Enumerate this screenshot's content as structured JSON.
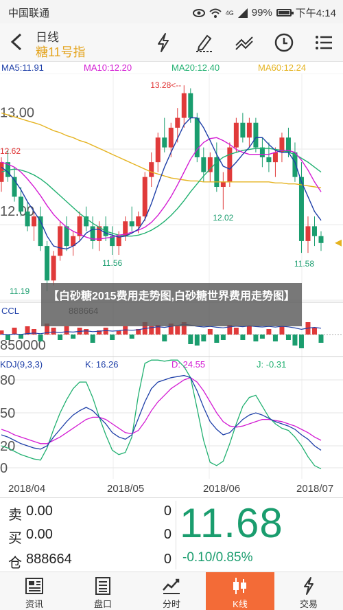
{
  "status": {
    "carrier": "中国联通",
    "signal_text": "4G",
    "battery": "99%",
    "time": "下午4:14"
  },
  "header": {
    "period": "日线",
    "instrument": "糖11号指"
  },
  "legend": {
    "ma5": "MA5:11.91",
    "ma10": "MA10:12.20",
    "ma20": "MA20:12.40",
    "ma60": "MA60:12.24",
    "colors": {
      "ma5": "#1e3fa8",
      "ma10": "#d31bd3",
      "ma20": "#20b070",
      "ma60": "#e5b320"
    }
  },
  "price_axis": [
    "13.00",
    "12.62",
    "12.00",
    "11.19"
  ],
  "annotations": {
    "high": "13.28<--",
    "low1": "11.56",
    "low2": "12.02",
    "low3": "11.58",
    "low0": "11.19<--"
  },
  "volume": {
    "label": "CCL",
    "value": "888664",
    "axis": "850000"
  },
  "kdj": {
    "label": "KDJ(9,3,3)",
    "k": "K: 16.26",
    "d": "D: 24.55",
    "j": "J: -0.31",
    "axis": [
      "80",
      "50",
      "20",
      "0"
    ]
  },
  "overlay_text": "【白砂糖2015费用走势图,白砂糖世界费用走势图】",
  "xaxis": [
    "2018/04",
    "2018/05",
    "2018/06",
    "2018/07"
  ],
  "quote": {
    "sell_label": "卖",
    "sell_value": "0.00",
    "sell_volume": "0",
    "buy_label": "买",
    "buy_value": "0.00",
    "buy_volume": "0",
    "position_label": "仓",
    "position_value": "888664",
    "position_volume": "0",
    "last_price": "11.68",
    "change": "-0.10/0.85%"
  },
  "tabs": [
    {
      "label": "资讯",
      "icon": "news-icon"
    },
    {
      "label": "盘口",
      "icon": "orderbook-icon"
    },
    {
      "label": "分时",
      "icon": "intraday-icon"
    },
    {
      "label": "K线",
      "icon": "candlestick-icon",
      "active": true
    },
    {
      "label": "交易",
      "icon": "trade-icon"
    }
  ],
  "chart_data": {
    "type": "candlestick",
    "title": "",
    "ylim": [
      11.1,
      13.4
    ],
    "candles": [
      [
        12.3,
        12.55,
        12.2,
        12.5
      ],
      [
        12.5,
        12.62,
        12.3,
        12.35
      ],
      [
        12.35,
        12.45,
        12.1,
        12.15
      ],
      [
        12.15,
        12.25,
        11.95,
        12.0
      ],
      [
        12.0,
        12.1,
        11.8,
        11.85
      ],
      [
        11.85,
        12.0,
        11.7,
        11.95
      ],
      [
        11.95,
        12.05,
        11.6,
        11.65
      ],
      [
        11.65,
        11.7,
        11.19,
        11.3
      ],
      [
        11.3,
        11.6,
        11.25,
        11.55
      ],
      [
        11.55,
        11.9,
        11.5,
        11.85
      ],
      [
        11.85,
        11.95,
        11.6,
        11.65
      ],
      [
        11.65,
        11.8,
        11.55,
        11.75
      ],
      [
        11.75,
        12.0,
        11.7,
        11.95
      ],
      [
        11.95,
        12.05,
        11.8,
        11.85
      ],
      [
        11.85,
        11.95,
        11.62,
        11.7
      ],
      [
        11.7,
        11.9,
        11.6,
        11.85
      ],
      [
        11.85,
        11.95,
        11.7,
        11.75
      ],
      [
        11.75,
        11.85,
        11.56,
        11.65
      ],
      [
        11.65,
        11.8,
        11.56,
        11.75
      ],
      [
        11.75,
        11.95,
        11.7,
        11.9
      ],
      [
        11.9,
        12.05,
        11.8,
        11.85
      ],
      [
        11.85,
        12.0,
        11.78,
        11.95
      ],
      [
        11.95,
        12.4,
        11.9,
        12.35
      ],
      [
        12.35,
        12.6,
        12.25,
        12.5
      ],
      [
        12.5,
        12.8,
        12.4,
        12.75
      ],
      [
        12.75,
        12.95,
        12.6,
        12.65
      ],
      [
        12.65,
        12.9,
        12.55,
        12.85
      ],
      [
        12.85,
        13.05,
        12.7,
        12.95
      ],
      [
        12.95,
        13.28,
        12.85,
        13.2
      ],
      [
        13.2,
        13.25,
        12.9,
        12.95
      ],
      [
        12.95,
        13.0,
        12.5,
        12.55
      ],
      [
        12.55,
        12.65,
        12.3,
        12.4
      ],
      [
        12.4,
        12.6,
        12.3,
        12.55
      ],
      [
        12.55,
        12.7,
        12.2,
        12.25
      ],
      [
        12.25,
        12.4,
        12.02,
        12.3
      ],
      [
        12.3,
        12.7,
        12.25,
        12.65
      ],
      [
        12.65,
        12.95,
        12.6,
        12.9
      ],
      [
        12.9,
        13.0,
        12.7,
        12.75
      ],
      [
        12.75,
        12.95,
        12.65,
        12.9
      ],
      [
        12.9,
        12.95,
        12.6,
        12.65
      ],
      [
        12.65,
        12.75,
        12.45,
        12.55
      ],
      [
        12.55,
        12.7,
        12.4,
        12.5
      ],
      [
        12.5,
        12.65,
        12.35,
        12.6
      ],
      [
        12.6,
        12.8,
        12.5,
        12.75
      ],
      [
        12.75,
        12.85,
        12.55,
        12.6
      ],
      [
        12.6,
        12.7,
        12.3,
        12.35
      ],
      [
        12.35,
        12.5,
        11.58,
        11.7
      ],
      [
        11.7,
        11.95,
        11.58,
        11.85
      ],
      [
        11.85,
        11.95,
        11.65,
        11.75
      ],
      [
        11.75,
        11.8,
        11.6,
        11.68
      ]
    ],
    "ma5": [
      12.45,
      12.4,
      12.32,
      12.22,
      12.1,
      12.0,
      11.9,
      11.75,
      11.65,
      11.63,
      11.62,
      11.65,
      11.7,
      11.78,
      11.82,
      11.82,
      11.78,
      11.76,
      11.74,
      11.75,
      11.78,
      11.82,
      11.92,
      12.08,
      12.27,
      12.45,
      12.6,
      12.74,
      12.88,
      12.95,
      12.95,
      12.85,
      12.72,
      12.58,
      12.46,
      12.43,
      12.5,
      12.58,
      12.65,
      12.75,
      12.75,
      12.68,
      12.62,
      12.6,
      12.6,
      12.5,
      12.3,
      12.15,
      12.0,
      11.91
    ],
    "ma10": [
      12.5,
      12.48,
      12.45,
      12.4,
      12.33,
      12.25,
      12.16,
      12.06,
      11.97,
      11.9,
      11.84,
      11.8,
      11.77,
      11.74,
      11.72,
      11.72,
      11.73,
      11.74,
      11.76,
      11.77,
      11.79,
      11.81,
      11.84,
      11.89,
      11.96,
      12.05,
      12.15,
      12.27,
      12.4,
      12.53,
      12.63,
      12.7,
      12.74,
      12.75,
      12.72,
      12.68,
      12.63,
      12.6,
      12.58,
      12.58,
      12.58,
      12.58,
      12.6,
      12.62,
      12.62,
      12.6,
      12.52,
      12.42,
      12.3,
      12.2
    ],
    "ma20": [
      12.4,
      12.42,
      12.43,
      12.42,
      12.4,
      12.37,
      12.33,
      12.28,
      12.22,
      12.16,
      12.1,
      12.04,
      11.98,
      11.93,
      11.88,
      11.84,
      11.8,
      11.78,
      11.76,
      11.75,
      11.75,
      11.76,
      11.78,
      11.81,
      11.85,
      11.9,
      11.96,
      12.03,
      12.11,
      12.2,
      12.28,
      12.36,
      12.43,
      12.5,
      12.55,
      12.58,
      12.6,
      12.62,
      12.63,
      12.64,
      12.64,
      12.64,
      12.63,
      12.62,
      12.6,
      12.58,
      12.54,
      12.5,
      12.45,
      12.4
    ],
    "ma60": [
      13.0,
      12.98,
      12.96,
      12.94,
      12.92,
      12.9,
      12.88,
      12.85,
      12.82,
      12.8,
      12.77,
      12.75,
      12.72,
      12.7,
      12.67,
      12.64,
      12.61,
      12.58,
      12.55,
      12.52,
      12.49,
      12.46,
      12.43,
      12.4,
      12.38,
      12.36,
      12.34,
      12.33,
      12.32,
      12.31,
      12.31,
      12.3,
      12.3,
      12.3,
      12.3,
      12.3,
      12.3,
      12.3,
      12.3,
      12.3,
      12.3,
      12.3,
      12.29,
      12.29,
      12.28,
      12.28,
      12.27,
      12.26,
      12.25,
      12.24
    ],
    "volume_bars": [
      0.3,
      -0.4,
      0.5,
      -0.3,
      0.6,
      0.4,
      -0.5,
      0.8,
      0.5,
      -0.4,
      0.6,
      -0.3,
      0.5,
      0.4,
      -0.6,
      0.3,
      0.5,
      -0.4,
      0.3,
      0.6,
      -0.3,
      0.4,
      0.9,
      0.6,
      0.7,
      -0.5,
      0.8,
      0.6,
      0.9,
      -0.7,
      -0.8,
      -0.5,
      0.4,
      -0.6,
      -0.4,
      0.7,
      0.5,
      -0.4,
      0.6,
      -0.5,
      -0.3,
      0.4,
      -0.5,
      0.6,
      -0.4,
      -0.8,
      -1.0,
      0.9,
      0.5,
      -0.6
    ],
    "kdj_k": [
      30,
      28,
      25,
      22,
      20,
      18,
      17,
      20,
      28,
      35,
      42,
      48,
      52,
      55,
      52,
      46,
      40,
      32,
      28,
      26,
      30,
      45,
      60,
      72,
      78,
      80,
      82,
      83,
      84,
      82,
      70,
      55,
      42,
      35,
      30,
      32,
      38,
      44,
      48,
      50,
      48,
      45,
      42,
      40,
      38,
      35,
      30,
      26,
      20,
      16
    ],
    "kdj_d": [
      35,
      33,
      30,
      28,
      26,
      24,
      22,
      22,
      25,
      28,
      32,
      36,
      40,
      44,
      46,
      46,
      44,
      40,
      36,
      32,
      31,
      34,
      42,
      52,
      60,
      66,
      72,
      76,
      80,
      82,
      78,
      70,
      60,
      50,
      42,
      38,
      37,
      38,
      40,
      42,
      44,
      44,
      43,
      42,
      40,
      38,
      35,
      32,
      28,
      25
    ],
    "kdj_j": [
      20,
      18,
      15,
      12,
      10,
      8,
      7,
      18,
      35,
      50,
      62,
      72,
      78,
      78,
      64,
      46,
      30,
      16,
      12,
      14,
      28,
      66,
      95,
      98,
      98,
      97,
      98,
      98,
      92,
      82,
      54,
      25,
      5,
      2,
      6,
      22,
      40,
      56,
      64,
      66,
      56,
      46,
      40,
      36,
      34,
      28,
      20,
      10,
      2,
      -1
    ]
  }
}
